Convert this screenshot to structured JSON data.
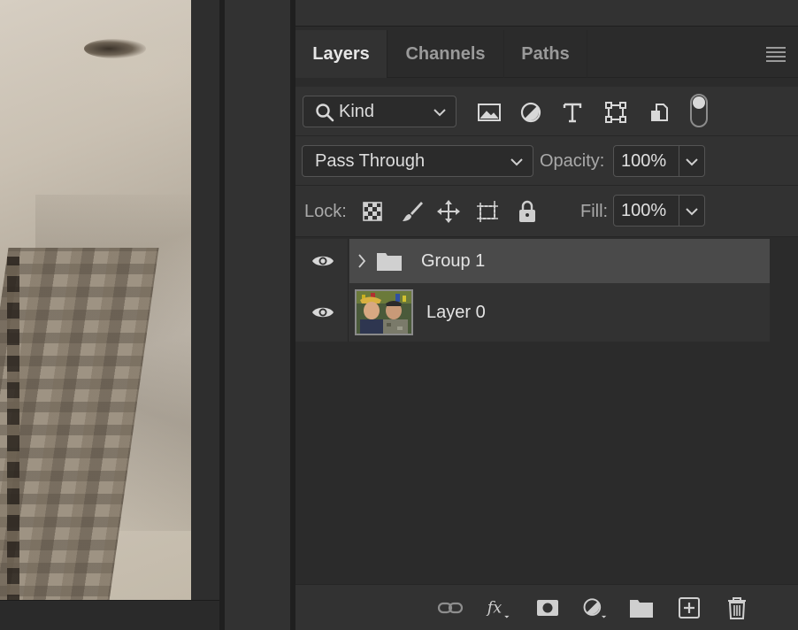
{
  "tabs": [
    {
      "label": "Layers",
      "active": true
    },
    {
      "label": "Channels",
      "active": false
    },
    {
      "label": "Paths",
      "active": false
    }
  ],
  "filter": {
    "kind_label": "Kind",
    "icons": [
      "pixel-layer-filter-icon",
      "adjustment-layer-filter-icon",
      "type-layer-filter-icon",
      "shape-layer-filter-icon",
      "smart-object-filter-icon"
    ],
    "filter_toggle_on": true
  },
  "blend": {
    "mode": "Pass Through",
    "opacity_label": "Opacity:",
    "opacity_value": "100%"
  },
  "lock": {
    "label": "Lock:",
    "icons": [
      "lock-transparent-pixels-icon",
      "lock-image-pixels-icon",
      "lock-position-icon",
      "lock-artboard-icon",
      "lock-all-icon"
    ],
    "fill_label": "Fill:",
    "fill_value": "100%"
  },
  "layers": [
    {
      "name": "Group 1",
      "type": "group",
      "visible": true,
      "selected": true,
      "collapsed": true
    },
    {
      "name": "Layer 0",
      "type": "pixel",
      "visible": true,
      "selected": false
    }
  ],
  "footer_icons": [
    "link-layers-icon",
    "layer-style-fx-icon",
    "add-mask-icon",
    "new-fill-adjustment-icon",
    "new-group-icon",
    "new-layer-icon",
    "delete-layer-icon"
  ],
  "colors": {
    "panel_bg": "#2b2b2b",
    "row_bg": "#323232",
    "selected_row": "#4a4a4a",
    "text": "#e4e4e4"
  }
}
